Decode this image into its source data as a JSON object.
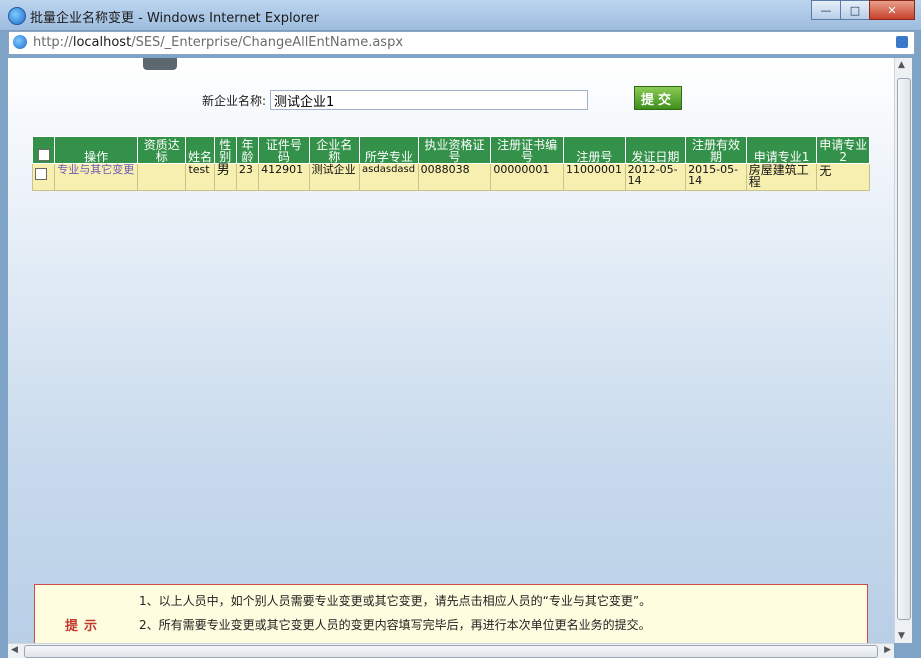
{
  "window": {
    "title": "批量企业名称变更 - Windows Internet Explorer",
    "min_label": "—",
    "max_label": "□",
    "close_label": "✕"
  },
  "address": {
    "url_prefix": "http://",
    "url_host": "localhost",
    "url_path": "/SES/_Enterprise/ChangeAllEntName.aspx"
  },
  "form": {
    "label": "新企业名称:",
    "value": "测试企业1",
    "submit_label": "提交"
  },
  "table": {
    "headers": [
      "",
      "操作",
      "资质达标",
      "姓名",
      "性别",
      "年龄",
      "证件号码",
      "企业名称",
      "所学专业",
      "执业资格证号",
      "注册证书编号",
      "注册号",
      "发证日期",
      "注册有效期",
      "申请专业1",
      "申请专业2"
    ],
    "rows": [
      {
        "action": "专业与其它变更",
        "qualified": "",
        "name": "test",
        "gender": "男",
        "age": "23",
        "id_no": "412901",
        "company": "测试企业",
        "major": "asdasdasd",
        "cert_no": "0088038",
        "reg_cert_no": "00000001",
        "reg_no": "11000001",
        "issue_date": "2012-05-14",
        "valid_date": "2015-05-14",
        "apply_major1": "房屋建筑工程",
        "apply_major2": "无"
      }
    ]
  },
  "hint": {
    "title": "提示",
    "line1": "1、以上人员中，如个别人员需要专业变更或其它变更，请先点击相应人员的“专业与其它变更”。",
    "line2": "2、所有需要专业变更或其它变更人员的变更内容填写完毕后，再进行本次单位更名业务的提交。"
  }
}
